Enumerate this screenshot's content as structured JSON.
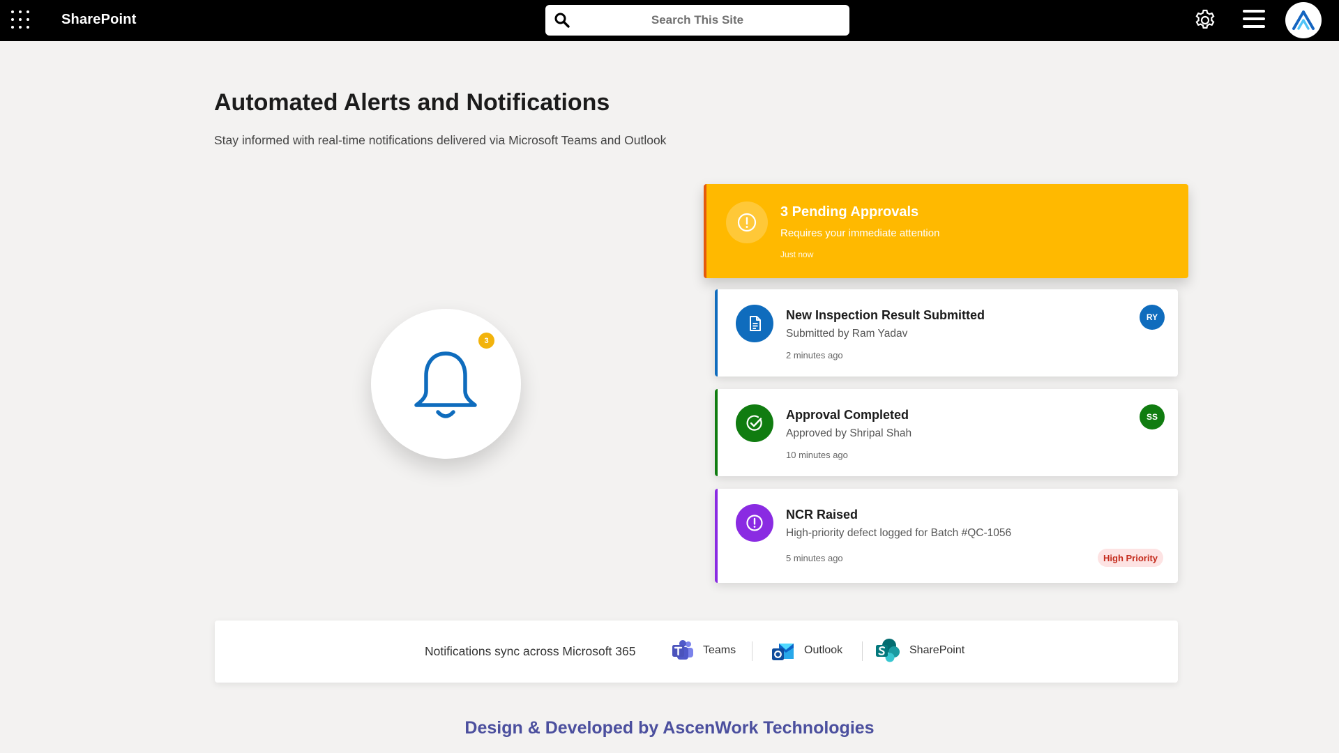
{
  "topbar": {
    "brand": "SharePoint",
    "search_placeholder": "Search This Site"
  },
  "page": {
    "title": "Automated Alerts and Notifications",
    "subtitle": "Stay informed with real-time notifications delivered via Microsoft Teams and Outlook"
  },
  "bell": {
    "badge_count": "3"
  },
  "alert": {
    "title": "3 Pending Approvals",
    "subtitle": "Requires your immediate attention",
    "time": "Just now",
    "color": "#ffb900",
    "accent": "#e55a0c"
  },
  "notifications": [
    {
      "title": "New Inspection Result Submitted",
      "subtitle": "Submitted by Ram Yadav",
      "time": "2 minutes ago",
      "icon": "document-icon",
      "icon_color": "#0f6cbd",
      "avatar": "RY",
      "avatar_color": "#0f6cbd",
      "accent": "#0f6cbd"
    },
    {
      "title": "Approval Completed",
      "subtitle": "Approved by Shripal Shah",
      "time": "10 minutes ago",
      "icon": "check-circle-icon",
      "icon_color": "#107c10",
      "avatar": "SS",
      "avatar_color": "#107c10",
      "accent": "#107c10"
    },
    {
      "title": "NCR Raised",
      "subtitle": "High-priority defect logged for Batch #QC-1056",
      "time": "5 minutes ago",
      "icon": "exclamation-circle-icon",
      "icon_color": "#8a2be2",
      "badge": "High Priority",
      "accent": "#8a2be2"
    }
  ],
  "sync": {
    "label": "Notifications sync across Microsoft 365",
    "apps": [
      "Teams",
      "Outlook",
      "SharePoint"
    ]
  },
  "footer": {
    "text": "Design & Developed by AscenWork Technologies"
  }
}
